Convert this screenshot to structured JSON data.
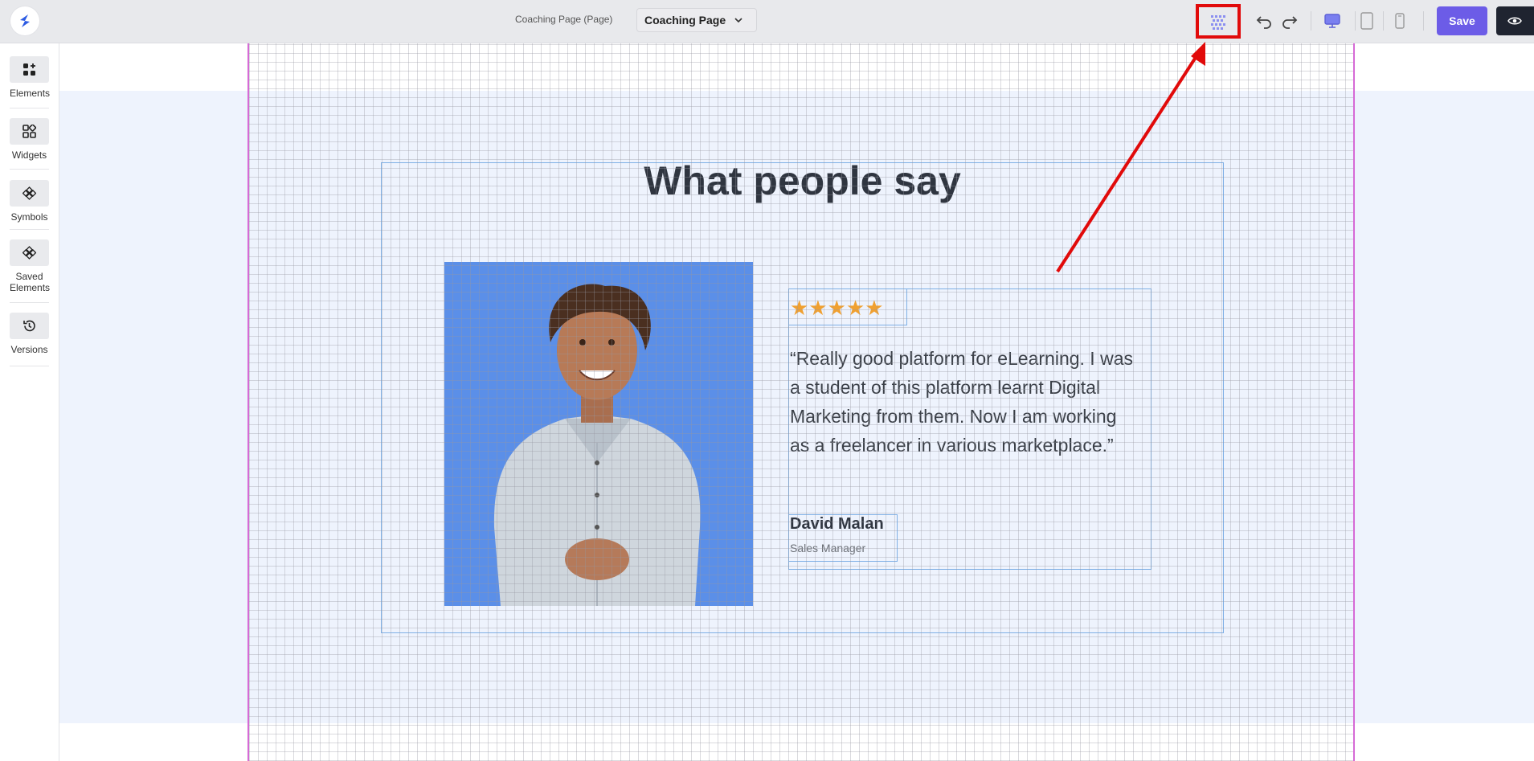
{
  "topbar": {
    "page_caption": "Coaching Page (Page)",
    "page_select_value": "Coaching Page",
    "save_label": "Save"
  },
  "sidebar": {
    "items": [
      {
        "label": "Elements",
        "icon": "elements-icon"
      },
      {
        "label": "Widgets",
        "icon": "widgets-icon"
      },
      {
        "label": "Symbols",
        "icon": "symbols-icon"
      },
      {
        "label": "Saved Elements",
        "icon": "saved-elements-icon"
      },
      {
        "label": "Versions",
        "icon": "history-icon"
      }
    ]
  },
  "testimonial": {
    "heading": "What people say",
    "rating": 5,
    "stars": "★★★★★",
    "quote": "“Really good platform for eLearning. I was a student of this platform learnt Digital Marketing from them. Now I am working as a freelancer in various marketplace.”",
    "author": "David Malan",
    "role": "Sales Manager"
  },
  "colors": {
    "accent": "#6c5ce7",
    "photo_bg": "#5b8fe8",
    "highlight": "#e10a0a",
    "star": "#f0a030"
  }
}
